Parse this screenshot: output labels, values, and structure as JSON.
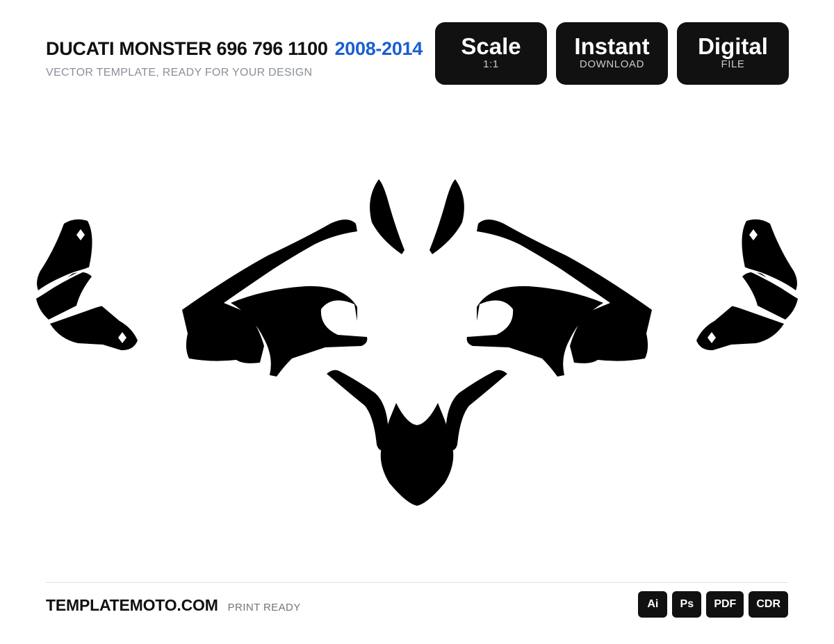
{
  "header": {
    "title": "DUCATI MONSTER 696 796 1100",
    "years": "2008-2014",
    "subtitle": "VECTOR TEMPLATE, READY FOR YOUR DESIGN",
    "accent_color": "#1a5fd0"
  },
  "badges": [
    {
      "big": "Scale",
      "small": "1:1"
    },
    {
      "big": "Instant",
      "small": "DOWNLOAD"
    },
    {
      "big": "Digital",
      "small": "FILE"
    }
  ],
  "footer": {
    "site": "TEMPLATEMOTO.COM",
    "tag": "PRINT READY",
    "formats": [
      "Ai",
      "Ps",
      "PDF",
      "CDR"
    ]
  }
}
